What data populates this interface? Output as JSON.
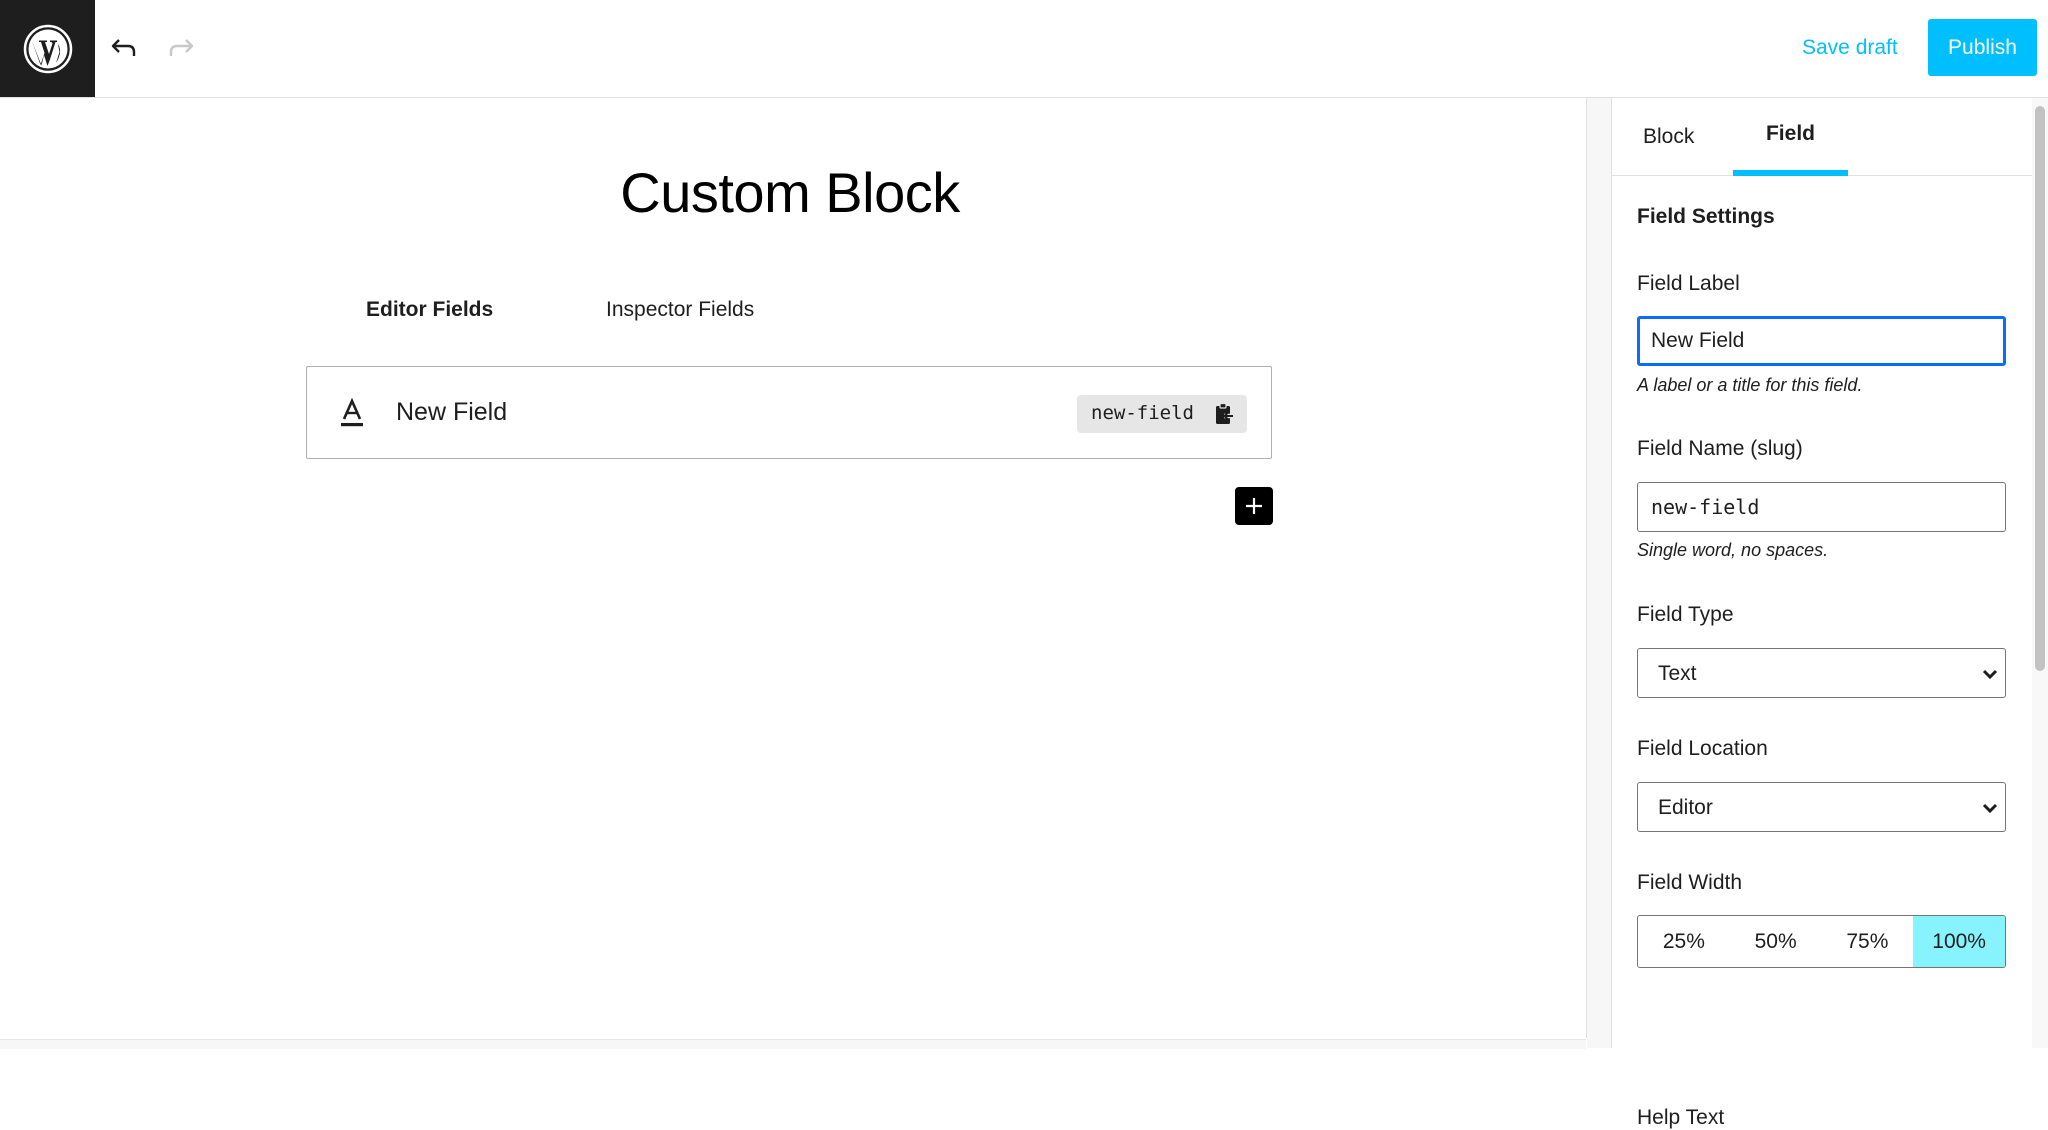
{
  "header": {
    "logo_icon": "wordpress-logo-icon",
    "undo_icon": "undo-icon",
    "redo_icon": "redo-icon",
    "save_draft_label": "Save draft",
    "publish_label": "Publish"
  },
  "editor": {
    "block_title": "Custom Block",
    "tabs": [
      {
        "label": "Editor Fields",
        "active": true
      },
      {
        "label": "Inspector Fields",
        "active": false
      }
    ],
    "fields": [
      {
        "icon": "text-field-icon",
        "label": "New Field",
        "slug": "new-field",
        "copy_icon": "clipboard-copy-icon"
      }
    ],
    "add_field_icon": "plus-icon"
  },
  "sidebar": {
    "tabs": [
      {
        "label": "Block",
        "active": false
      },
      {
        "label": "Field",
        "active": true
      }
    ],
    "section_title": "Field Settings",
    "field_label": {
      "label": "Field Label",
      "value": "New Field",
      "help": "A label or a title for this field."
    },
    "field_name": {
      "label": "Field Name (slug)",
      "value": "new-field",
      "help": "Single word, no spaces."
    },
    "field_type": {
      "label": "Field Type",
      "selected": "Text"
    },
    "field_location": {
      "label": "Field Location",
      "selected": "Editor"
    },
    "field_width": {
      "label": "Field Width",
      "options": [
        "25%",
        "50%",
        "75%",
        "100%"
      ],
      "selected": "100%"
    },
    "help_text": {
      "label": "Help Text"
    }
  },
  "colors": {
    "accent": "#00bfff",
    "focus": "#0a6cff",
    "selected_width": "#87f3ff",
    "logo_bg": "#1e1e1e"
  }
}
